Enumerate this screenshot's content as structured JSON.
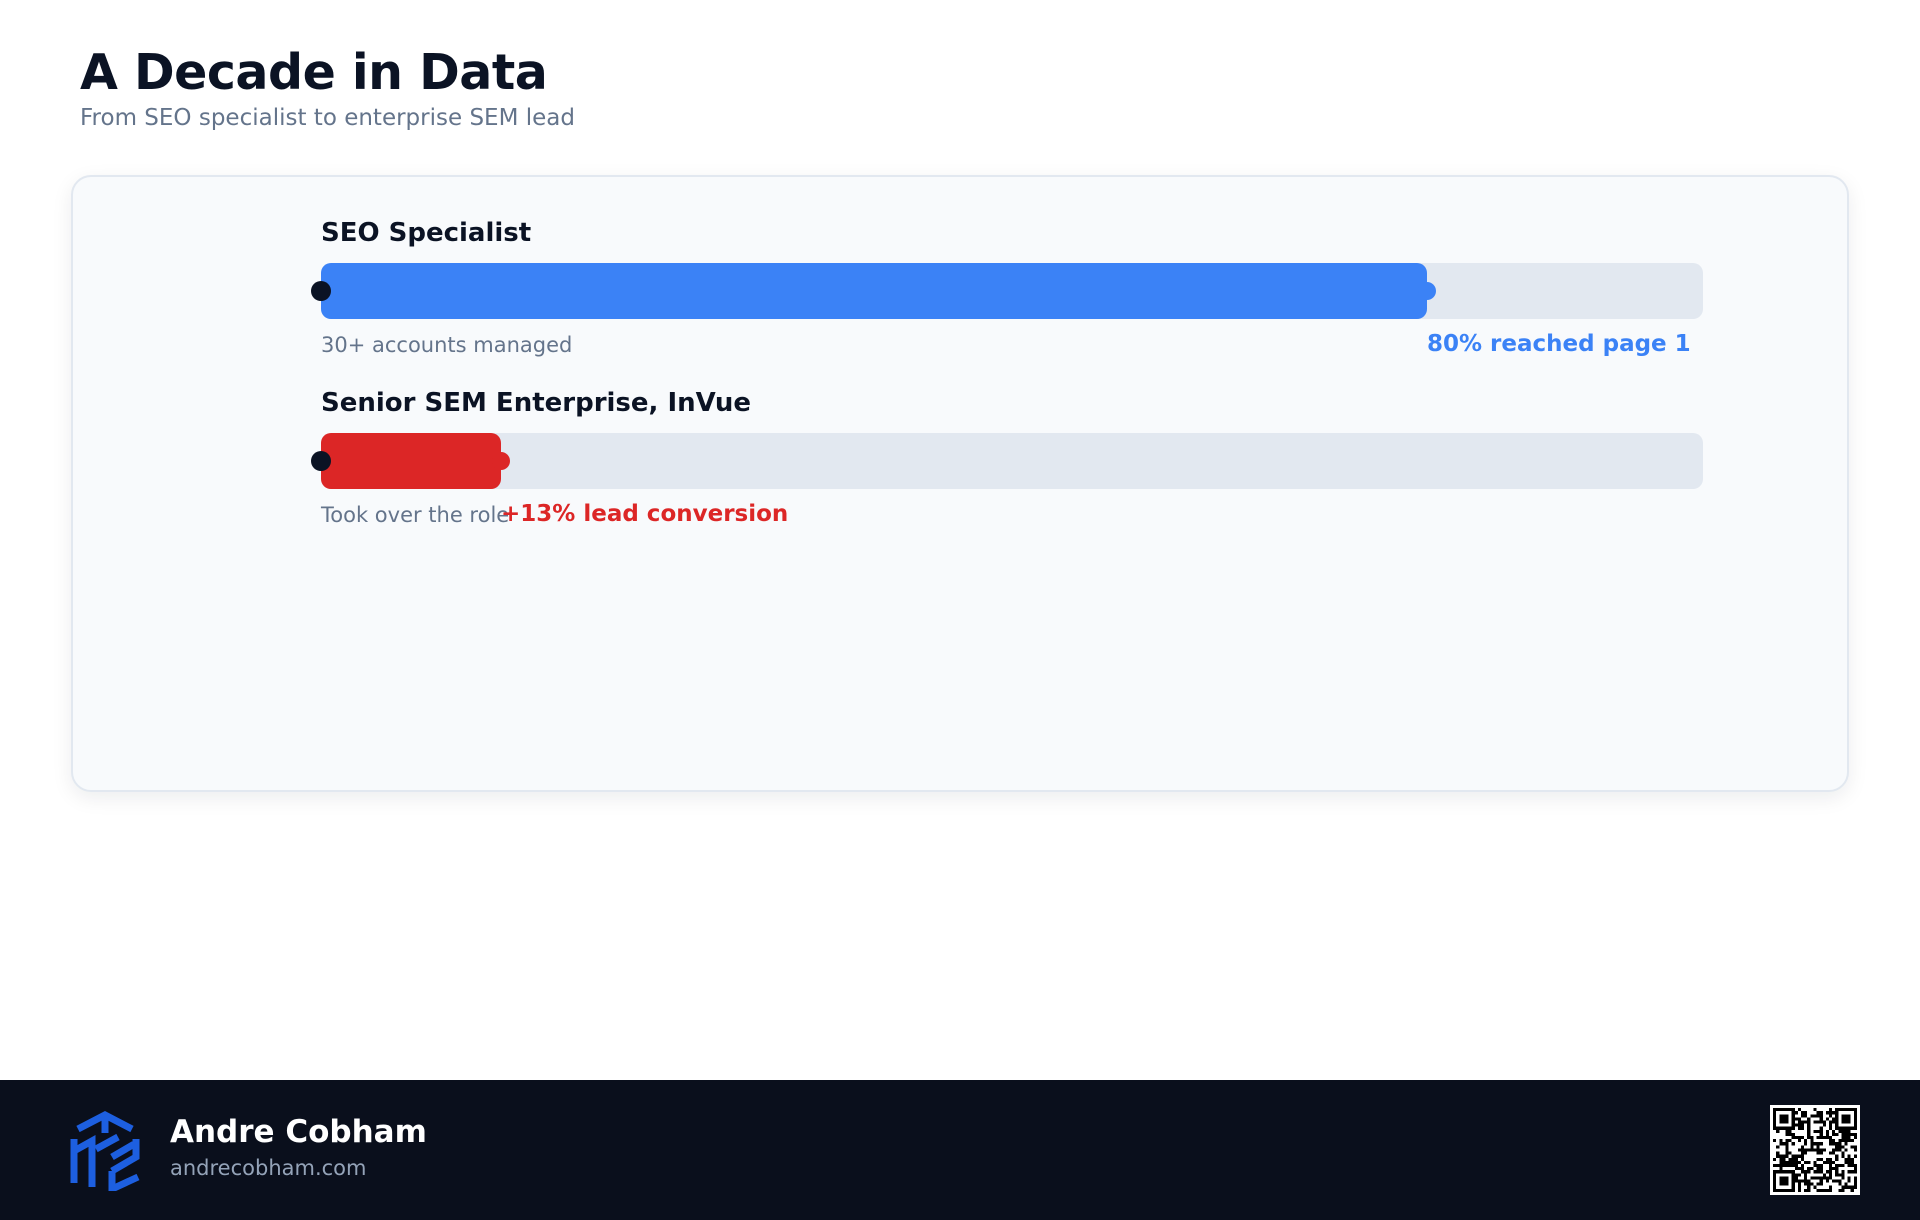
{
  "header": {
    "title": "A Decade in Data",
    "subtitle": "From SEO specialist to enterprise SEM lead"
  },
  "roles": [
    {
      "role": "SEO Specialist",
      "caption": "30+ accounts managed",
      "metric": "80% reached page 1",
      "progress_percent": 80,
      "color": "#3b82f6"
    },
    {
      "role": "Senior SEM Enterprise, InVue",
      "caption": "Took over the role",
      "metric": "+13% lead conversion",
      "progress_percent": 13,
      "color": "#dc2626"
    }
  ],
  "footer": {
    "name": "Andre Cobham",
    "website": "andrecobham.com",
    "logo_icon": "cube-logo-icon",
    "qr_icon": "qr-code-icon",
    "logo_color": "#1d5fe0"
  }
}
